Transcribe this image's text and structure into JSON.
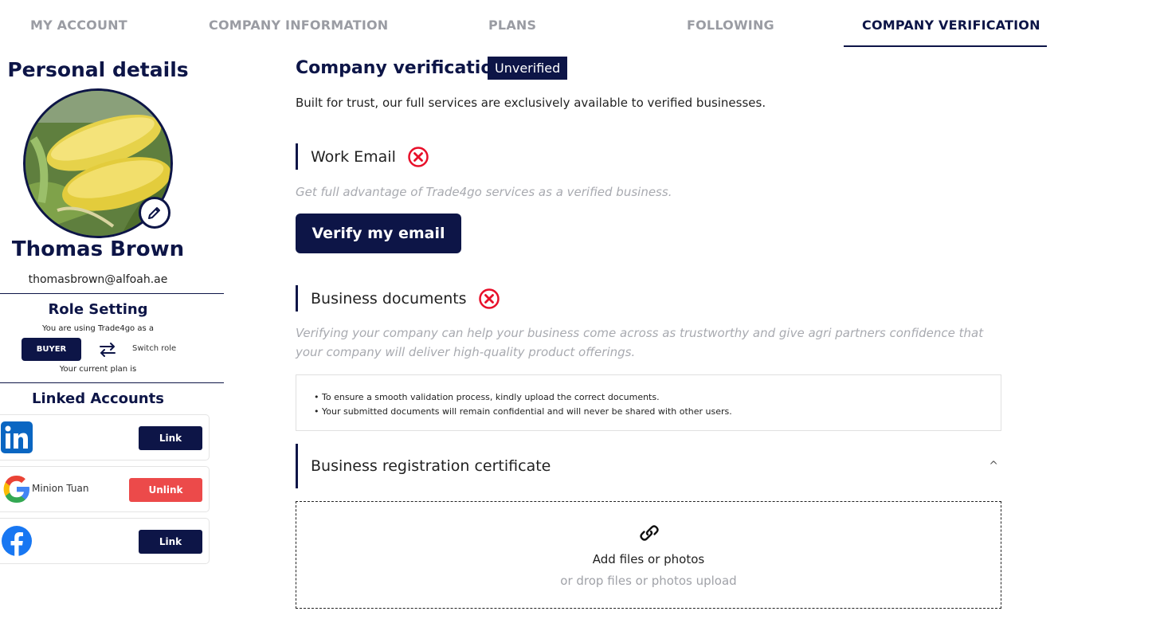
{
  "tabs": [
    {
      "label": "MY ACCOUNT",
      "active": false
    },
    {
      "label": "COMPANY INFORMATION",
      "active": false
    },
    {
      "label": "PLANS",
      "active": false
    },
    {
      "label": "FOLLOWING",
      "active": false
    },
    {
      "label": "COMPANY VERIFICATION",
      "active": true
    }
  ],
  "sidebar": {
    "title": "Personal details",
    "avatar_icon": "corn-photo",
    "edit_icon": "pencil-icon",
    "name": "Thomas Brown",
    "email": "thomasbrown@alfoah.ae",
    "role_setting": {
      "title": "Role Setting",
      "using_text": "You are using Trade4go as a",
      "role": "BUYER",
      "switch_label": "Switch role",
      "plan_text": "Your current plan is"
    },
    "linked_accounts": {
      "title": "Linked Accounts",
      "items": [
        {
          "provider": "linkedin",
          "icon": "linkedin-icon",
          "name": "",
          "action": "Link"
        },
        {
          "provider": "google",
          "icon": "google-icon",
          "name": "Minion Tuan",
          "action": "Unlink"
        },
        {
          "provider": "facebook",
          "icon": "facebook-icon",
          "name": "",
          "action": "Link"
        }
      ]
    }
  },
  "main": {
    "title": "Company verification",
    "status_badge": "Unverified",
    "intro": "Built for trust, our full services are exclusively available to verified businesses.",
    "work_email": {
      "title": "Work Email",
      "status_icon": "error-x-icon",
      "description": "Get full advantage of Trade4go services as a verified business.",
      "button": "Verify my email"
    },
    "business_documents": {
      "title": "Business documents",
      "status_icon": "error-x-icon",
      "description_line1": "Verifying your company can help your business come across as trustworthy and give agri partners confidence that",
      "description_line2": "your company will deliver high-quality product offerings.",
      "notes": [
        "To ensure a smooth validation process, kindly upload the correct documents.",
        "Your submitted documents will remain confidential and will never be shared with other users."
      ]
    },
    "certificate": {
      "title": "Business registration certificate",
      "chevron": "^",
      "upload_icon": "link-icon",
      "upload_main": "Add files or photos",
      "upload_sub": "or drop files or photos upload"
    }
  },
  "colors": {
    "navy": "#0d1547",
    "error_red": "#e8102a",
    "unlink_red": "#ec4a4a",
    "muted_text": "#a8aab0"
  }
}
